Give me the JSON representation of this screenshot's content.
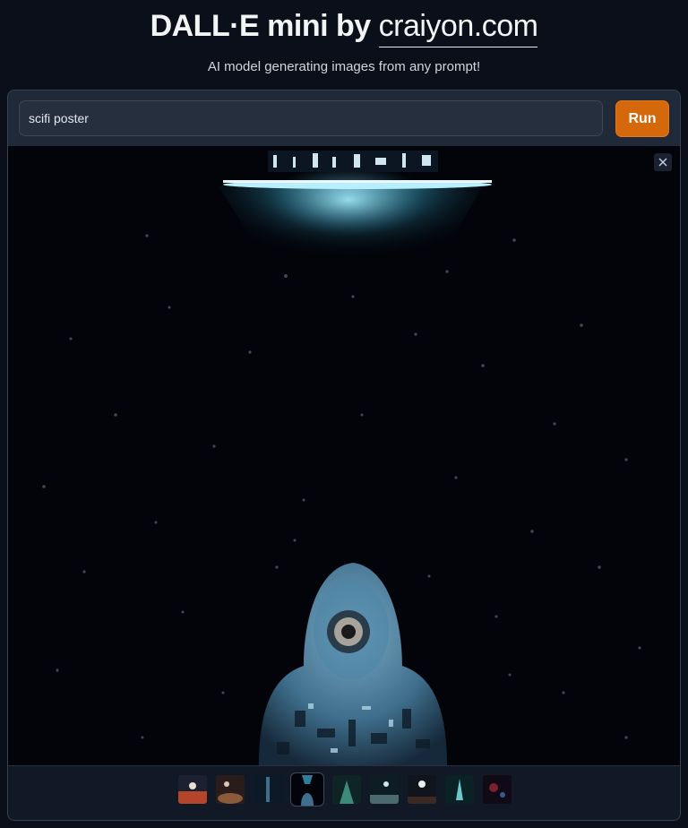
{
  "header": {
    "title_main": "DALL·E mini by",
    "title_link": "craiyon.com",
    "subtitle": "AI model generating images from any prompt!"
  },
  "prompt": {
    "value": "scifi poster",
    "placeholder": ""
  },
  "run_label": "Run",
  "viewer": {
    "close_icon": "close-icon",
    "image": "astronaut-spaceship-poster"
  },
  "gallery": {
    "count": 9,
    "selected_index": 3,
    "thumbnails": [
      {
        "name": "thumbnail-1"
      },
      {
        "name": "thumbnail-2"
      },
      {
        "name": "thumbnail-3"
      },
      {
        "name": "thumbnail-4"
      },
      {
        "name": "thumbnail-5"
      },
      {
        "name": "thumbnail-6"
      },
      {
        "name": "thumbnail-7"
      },
      {
        "name": "thumbnail-8"
      },
      {
        "name": "thumbnail-9"
      }
    ]
  },
  "colors": {
    "background": "#0b0f19",
    "panel": "#1f2937",
    "accent": "#d4680a"
  }
}
